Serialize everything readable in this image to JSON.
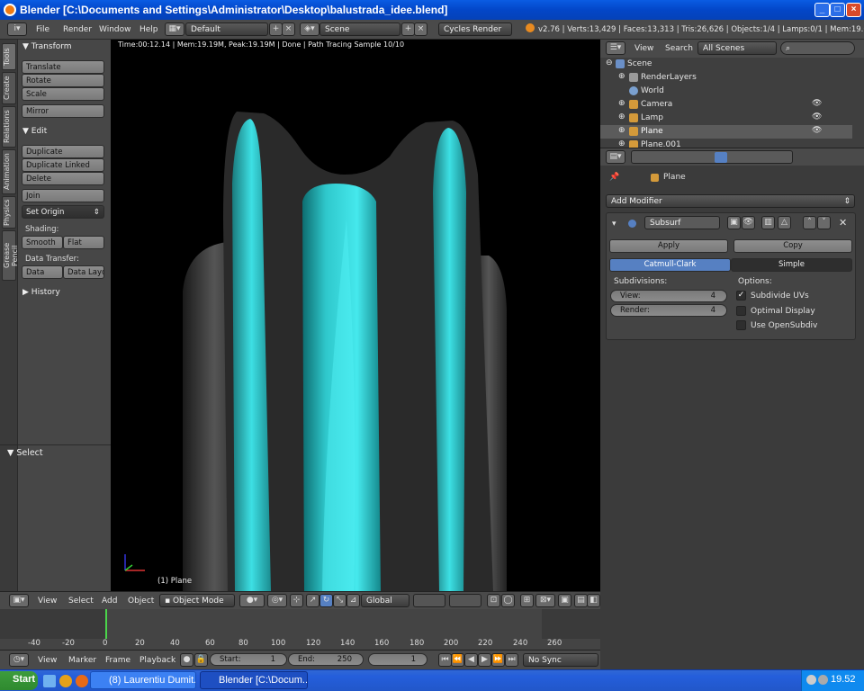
{
  "window": {
    "title": "Blender [C:\\Documents and Settings\\Administrator\\Desktop\\balustrada_idee.blend]"
  },
  "infobar": {
    "menus": [
      "File",
      "Render",
      "Window",
      "Help"
    ],
    "layout": "Default",
    "scene": "Scene",
    "engine": "Cycles Render",
    "stats": "v2.76 | Verts:13,429 | Faces:13,313 | Tris:26,626 | Objects:1/4 | Lamps:0/1 | Mem:19.04M (0."
  },
  "lefttabs": [
    "Tools",
    "Create",
    "Relations",
    "Animation",
    "Physics",
    "Grease Pencil"
  ],
  "toolpanel": {
    "transform_header": "Transform",
    "translate": "Translate",
    "rotate": "Rotate",
    "scale": "Scale",
    "mirror": "Mirror",
    "edit_header": "Edit",
    "duplicate": "Duplicate",
    "duplicate_linked": "Duplicate Linked",
    "delete": "Delete",
    "join": "Join",
    "set_origin": "Set Origin",
    "shading_label": "Shading:",
    "smooth": "Smooth",
    "flat": "Flat",
    "data_transfer_label": "Data Transfer:",
    "data": "Data",
    "data_layout": "Data Layo",
    "history_header": "History",
    "select_header": "Select"
  },
  "viewport": {
    "info": "Time:00:12.14 | Mem:19.19M, Peak:19.19M | Done | Path Tracing Sample 10/10",
    "object_label": "(1) Plane"
  },
  "vpheader": {
    "menus": [
      "View",
      "Select",
      "Add",
      "Object"
    ],
    "mode": "Object Mode",
    "orientation": "Global"
  },
  "timeline": {
    "ticks": [
      "-40",
      "-20",
      "0",
      "20",
      "40",
      "60",
      "80",
      "100",
      "120",
      "140",
      "160",
      "180",
      "200",
      "220",
      "240",
      "260"
    ],
    "menus": [
      "View",
      "Marker",
      "Frame",
      "Playback"
    ],
    "start": "Start:",
    "start_val": "1",
    "end": "End:",
    "end_val": "250",
    "current": "1",
    "sync": "No Sync"
  },
  "outliner": {
    "menus": [
      "View",
      "Search"
    ],
    "filter": "All Scenes",
    "rows": [
      {
        "label": "Scene",
        "color": "#6a8fc7"
      },
      {
        "label": "RenderLayers",
        "color": "#9a9a9a"
      },
      {
        "label": "World",
        "color": "#7aa0d0"
      },
      {
        "label": "Camera",
        "color": "#d49a3a"
      },
      {
        "label": "Lamp",
        "color": "#d49a3a"
      },
      {
        "label": "Plane",
        "color": "#d49a3a"
      },
      {
        "label": "Plane.001",
        "color": "#d49a3a"
      }
    ]
  },
  "properties": {
    "object": "Plane",
    "add_modifier": "Add Modifier",
    "modifier_name": "Subsurf",
    "apply": "Apply",
    "copy": "Copy",
    "catmull": "Catmull-Clark",
    "simple": "Simple",
    "subdivisions_label": "Subdivisions:",
    "view_label": "View:",
    "view_val": "4",
    "render_label": "Render:",
    "render_val": "4",
    "options_label": "Options:",
    "subdivide_uvs": "Subdivide UVs",
    "optimal_display": "Optimal Display",
    "use_opensubdiv": "Use OpenSubdiv"
  },
  "taskbar": {
    "start": "Start",
    "tasks": [
      "(8) Laurentiu Dumit...",
      "Blender [C:\\Docum..."
    ],
    "clock": "19.52"
  }
}
